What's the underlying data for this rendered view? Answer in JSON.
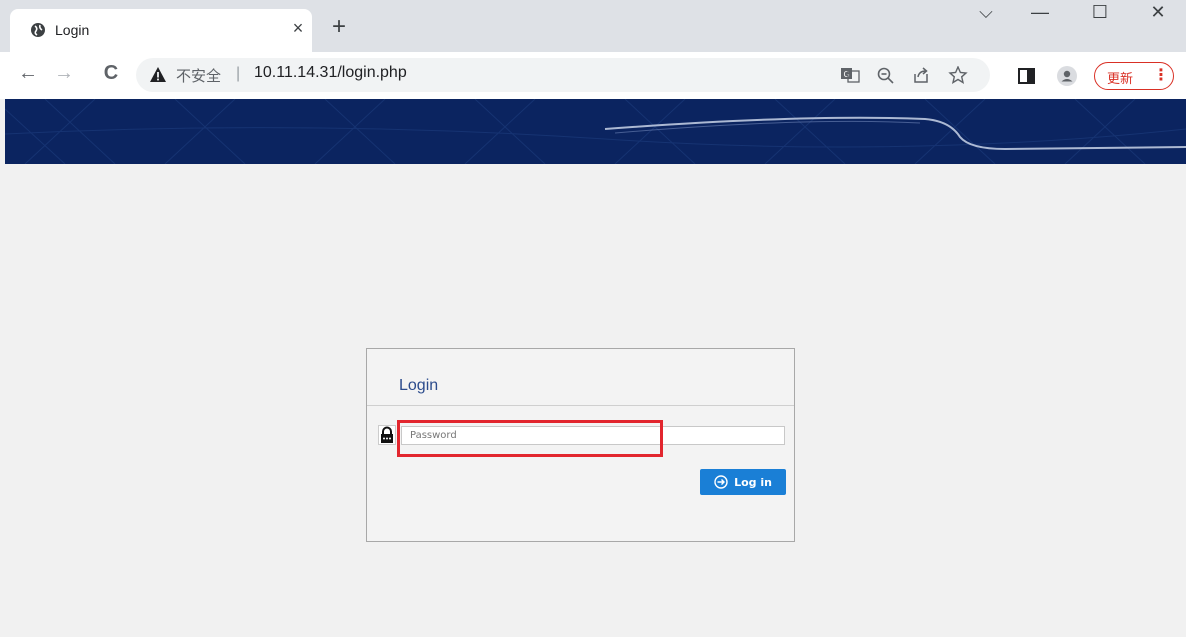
{
  "browser": {
    "tab_title": "Login",
    "tab_close": "×",
    "new_tab": "+",
    "window_controls": {
      "dropdown": "⌵",
      "minimize": "—",
      "maximize": "☐",
      "close": "✕"
    },
    "nav": {
      "back": "←",
      "forward": "→",
      "reload": "C"
    },
    "security_label": "不安全",
    "separator": "|",
    "url": "10.11.14.31/login.php",
    "update_label": "更新",
    "update_menu": "⋮"
  },
  "login": {
    "title": "Login",
    "password_placeholder": "Password",
    "password_value": "",
    "submit_label": "Log in"
  },
  "colors": {
    "banner": "#0b2460",
    "highlight": "#e2262e",
    "login_button": "#1a7fd6",
    "title_text": "#2b4b8c"
  }
}
